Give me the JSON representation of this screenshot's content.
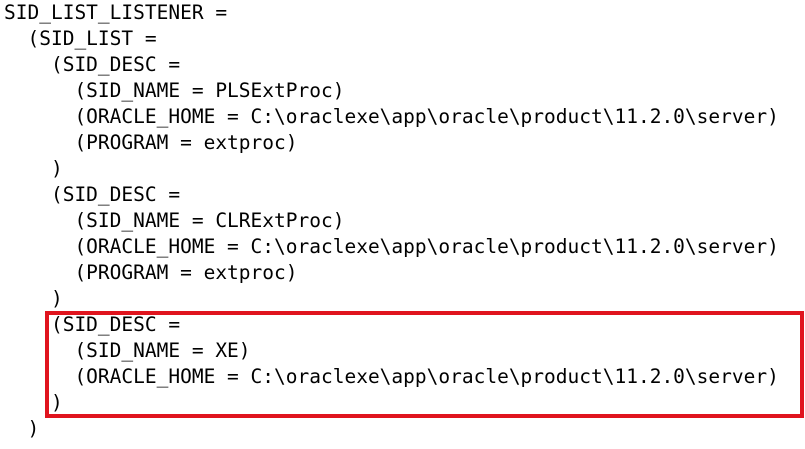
{
  "document": {
    "lines": [
      "SID_LIST_LISTENER =",
      "  (SID_LIST =",
      "    (SID_DESC =",
      "      (SID_NAME = PLSExtProc)",
      "      (ORACLE_HOME = C:\\oraclexe\\app\\oracle\\product\\11.2.0\\server)",
      "      (PROGRAM = extproc)",
      "    )",
      "    (SID_DESC =",
      "      (SID_NAME = CLRExtProc)",
      "      (ORACLE_HOME = C:\\oraclexe\\app\\oracle\\product\\11.2.0\\server)",
      "      (PROGRAM = extproc)",
      "    )",
      "    (SID_DESC =",
      "      (SID_NAME = XE)",
      "      (ORACLE_HOME = C:\\oraclexe\\app\\oracle\\product\\11.2.0\\server)",
      "    )",
      "  )"
    ],
    "highlight_color": "#e0141e"
  }
}
